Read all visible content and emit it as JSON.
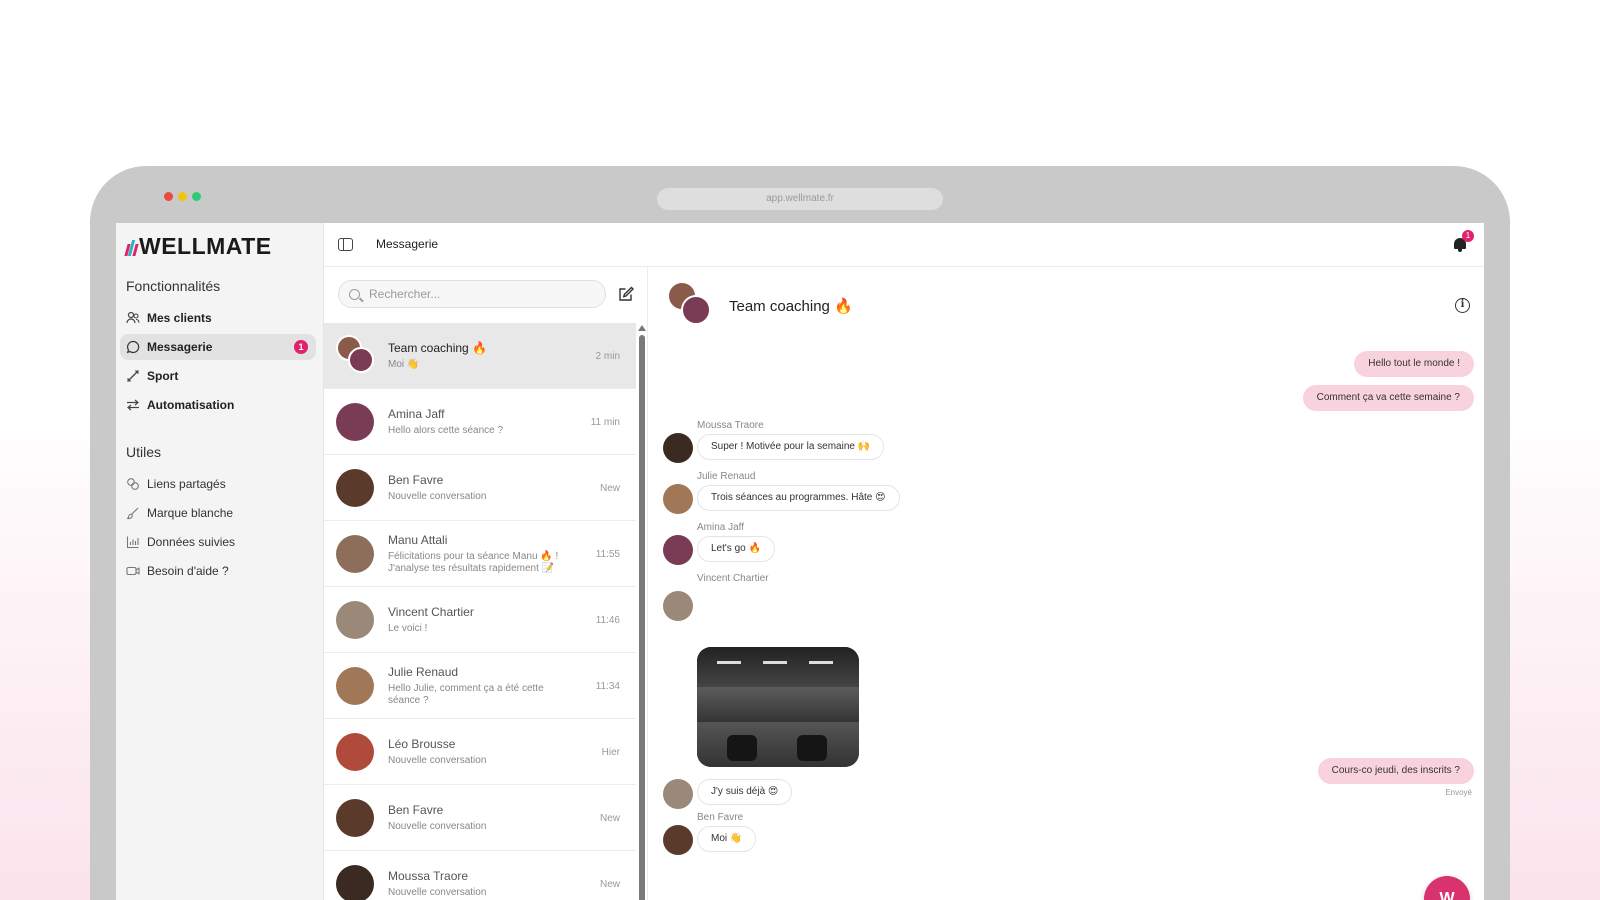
{
  "browser": {
    "url": "app.wellmate.fr",
    "traffic_colors": [
      "#e74c3c",
      "#f1c40f",
      "#2ecc71"
    ]
  },
  "brand": {
    "name": "WELLMATE",
    "accent": "#e0216e",
    "logo_colors": [
      "#e0216e",
      "#2bb3c0",
      "#e0216e"
    ]
  },
  "sidebar": {
    "section1_title": "Fonctionnalités",
    "section1_items": [
      {
        "label": "Mes clients",
        "icon": "users-icon"
      },
      {
        "label": "Messagerie",
        "icon": "chat-bubble-icon",
        "badge": "1"
      },
      {
        "label": "Sport",
        "icon": "dumbbell-icon"
      },
      {
        "label": "Automatisation",
        "icon": "arrows-swap-icon"
      }
    ],
    "section2_title": "Utiles",
    "section2_items": [
      {
        "label": "Liens partagés",
        "icon": "link-icon"
      },
      {
        "label": "Marque blanche",
        "icon": "brush-icon"
      },
      {
        "label": "Données suivies",
        "icon": "bar-chart-icon"
      },
      {
        "label": "Besoin d'aide ?",
        "icon": "video-icon"
      }
    ]
  },
  "topbar": {
    "title": "Messagerie",
    "notification_count": "1"
  },
  "list": {
    "search_placeholder": "Rechercher...",
    "conversations": [
      {
        "name": "Team coaching 🔥",
        "preview": "Moi 👋",
        "time": "2 min",
        "color": "#8a5a4a",
        "color2": "#7a3b55"
      },
      {
        "name": "Amina Jaff",
        "preview": "Hello alors cette séance ?",
        "time": "11 min",
        "color": "#7a3b55"
      },
      {
        "name": "Ben Favre",
        "preview": "Nouvelle conversation",
        "time": "New",
        "color": "#5a3a2a"
      },
      {
        "name": "Manu Attali",
        "preview": "Félicitations pour ta séance Manu 🔥 ! J'analyse tes résultats rapidement 📝",
        "time": "11:55",
        "color": "#8c6e5a"
      },
      {
        "name": "Vincent Chartier",
        "preview": "Le voici !",
        "time": "11:46",
        "color": "#9a8878"
      },
      {
        "name": "Julie Renaud",
        "preview": "Hello Julie, comment ça a été cette séance ?",
        "time": "11:34",
        "color": "#a07858"
      },
      {
        "name": "Léo Brousse",
        "preview": "Nouvelle conversation",
        "time": "Hier",
        "color": "#b04a3a"
      },
      {
        "name": "Ben Favre",
        "preview": "Nouvelle conversation",
        "time": "New",
        "color": "#5a3a2a"
      },
      {
        "name": "Moussa Traore",
        "preview": "Nouvelle conversation",
        "time": "New",
        "color": "#3a2a22"
      }
    ]
  },
  "chat": {
    "title": "Team coaching 🔥",
    "outgoing_1": "Hello tout le monde !",
    "outgoing_2": "Comment ça va cette semaine ?",
    "msg_moussa_sender": "Moussa Traore",
    "msg_moussa_text": "Super ! Motivée pour la semaine 🙌",
    "msg_julie_sender": "Julie Renaud",
    "msg_julie_text": "Trois séances au programmes. Hâte 😍",
    "msg_amina_sender": "Amina Jaff",
    "msg_amina_text": "Let's go 🔥",
    "msg_vincent_sender": "Vincent Chartier",
    "msg_vincent_text": "J'y suis déjà 😍",
    "outgoing_3": "Cours-co jeudi, des inscrits ?",
    "sent_label": "Envoyé",
    "msg_ben_sender": "Ben Favre",
    "msg_ben_text": "Moi 👋"
  }
}
